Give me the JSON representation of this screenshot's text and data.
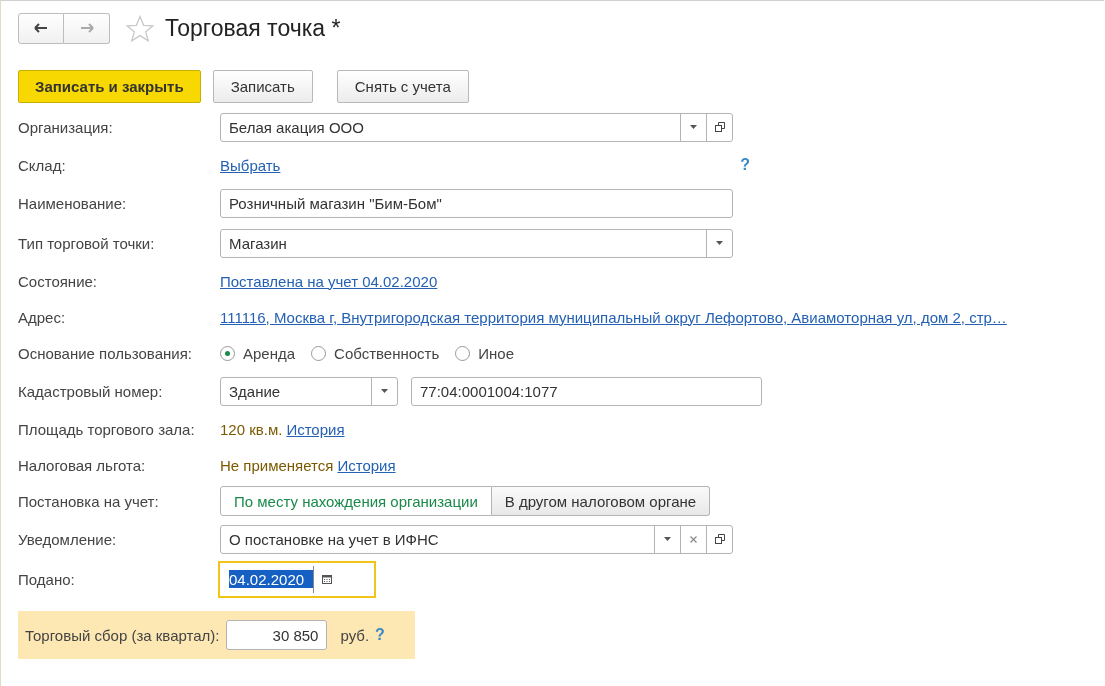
{
  "window": {
    "title": "Торговая точка *",
    "favorite": false
  },
  "nav": {
    "back_disabled": false,
    "forward_disabled": true
  },
  "buttons": [
    {
      "label": "Записать и закрыть",
      "default": true
    },
    {
      "label": "Записать",
      "default": false
    },
    {
      "label": "Снять с учета",
      "default": false
    }
  ],
  "fields": [
    {
      "kind": "select",
      "label": "Организация:",
      "value": "Белая акация ООО",
      "clear": false,
      "open": true
    },
    {
      "kind": "link",
      "label": "Склад:",
      "link": "Выбрать",
      "help": "?"
    },
    {
      "kind": "input",
      "label": "Наименование:",
      "value": "Розничный магазин \"Бим-Бом\""
    },
    {
      "kind": "select",
      "label": "Тип торговой точки:",
      "value": "Магазин",
      "clear": false,
      "open": false
    },
    {
      "kind": "link",
      "label": "Состояние:",
      "link": "Поставлена на учет 04.02.2020"
    },
    {
      "kind": "link",
      "label": "Адрес:",
      "link": "111116, Москва г, Внутригородская территория муниципальный округ Лефортово, Авиамоторная ул, дом 2, стр…"
    },
    {
      "kind": "radio",
      "label": "Основание пользования:",
      "options": [
        {
          "label": "Аренда",
          "selected": true
        },
        {
          "label": "Собственность",
          "selected": false
        },
        {
          "label": "Иное",
          "selected": false
        }
      ]
    },
    {
      "kind": "cadastre",
      "label": "Кадастровый номер:",
      "type": "Здание",
      "value": "77:04:0001004:1077"
    },
    {
      "kind": "info",
      "label": "Площадь торгового зала:",
      "text": "120 кв.м.",
      "link": "История"
    },
    {
      "kind": "info",
      "label": "Налоговая льгота:",
      "text": "Не применяется",
      "link": "История"
    },
    {
      "kind": "toggle",
      "label": "Постановка на учет:",
      "options": [
        {
          "label": "По месту нахождения организации",
          "selected": true
        },
        {
          "label": "В другом налоговом органе",
          "selected": false
        }
      ]
    },
    {
      "kind": "select",
      "label": "Уведомление:",
      "value": "О постановке на учет в ИФНС",
      "clear": true,
      "open": true
    },
    {
      "kind": "date",
      "label": "Подано:",
      "value": "04.02.2020",
      "focused": true
    }
  ],
  "tax": {
    "label": "Торговый сбор (за квартал):",
    "value": "30 850",
    "unit": "руб.",
    "help": "?"
  }
}
